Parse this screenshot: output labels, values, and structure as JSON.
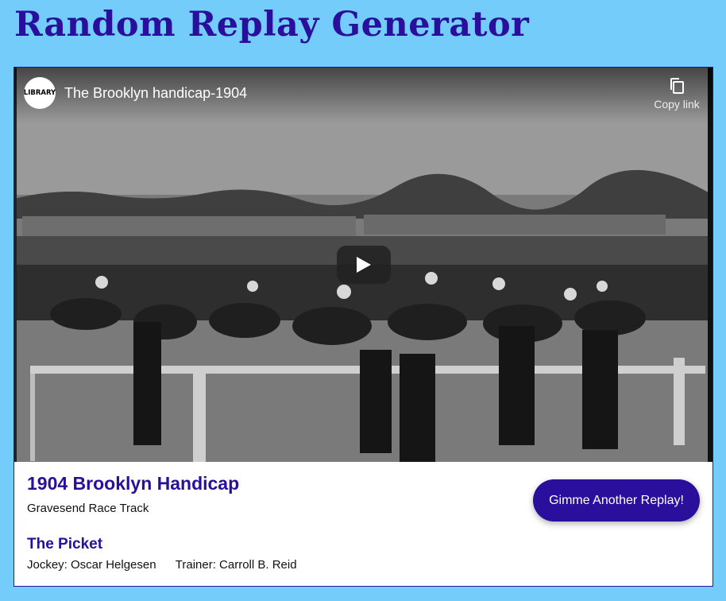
{
  "header": {
    "title": "Random Replay Generator"
  },
  "video": {
    "channel_logo_text": "LIBRARY",
    "title": "The Brooklyn handicap-1904",
    "copy_link_label": "Copy link",
    "copy_icon": "copy-icon",
    "play_icon": "play-icon"
  },
  "race": {
    "name": "1904 Brooklyn Handicap",
    "track": "Gravesend Race Track"
  },
  "winner": {
    "horse": "The Picket",
    "jockey": "Jockey: Oscar Helgesen",
    "trainer": "Trainer: Carroll B. Reid"
  },
  "actions": {
    "replay_label": "Gimme Another Replay!"
  },
  "colors": {
    "background": "#74ccfb",
    "accent": "#2a0f9c"
  }
}
